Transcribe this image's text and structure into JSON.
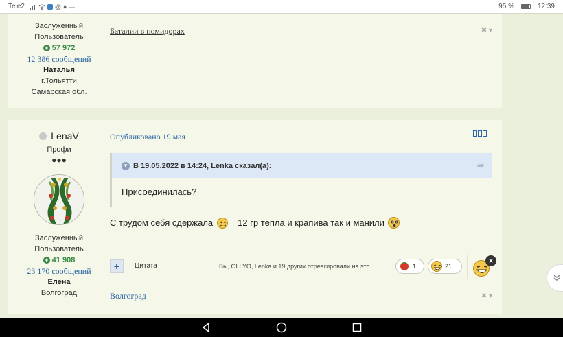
{
  "status_bar": {
    "carrier": "Tele2",
    "battery": "95 %",
    "time": "12:39",
    "extra": "···"
  },
  "post1": {
    "author": {
      "rank_line1": "Заслуженный",
      "rank_line2": "Пользователь",
      "reputation": "57 972",
      "messages": "12 386 сообщений",
      "name": "Наталья",
      "city": "г.Тольятти",
      "region": "Самарская обл."
    },
    "signature_link": "Баталии в помидорах"
  },
  "post2": {
    "author": {
      "username": "LenaV",
      "group": "Профи",
      "pips": "●●●",
      "rank_line1": "Заслуженный",
      "rank_line2": "Пользователь",
      "reputation": "41 908",
      "messages": "23 170 сообщений",
      "name": "Елена",
      "city": "Волгоград"
    },
    "posted": "Опубликовано 19 мая",
    "quote": {
      "header": "В 19.05.2022 в 14:24, Lenka сказал(а):",
      "text": "Присоединилась?"
    },
    "content": {
      "part1": "С трудом себя сдержала",
      "part2": "12 гр тепла и крапива так и манили"
    },
    "actions": {
      "quote_label": "Цитата",
      "reacted_text": "Вы, OLLYO, Lenka и 19 других отреагировали на это",
      "reaction1_count": "1",
      "reaction2_count": "21"
    },
    "signature_link": "Волгоград"
  },
  "colors": {
    "page_bg": "#ebf0dc",
    "post_bg": "#f5f7e8",
    "link": "#2a65a6",
    "reputation": "#3a8a46",
    "quote_header": "#dce8f5"
  }
}
